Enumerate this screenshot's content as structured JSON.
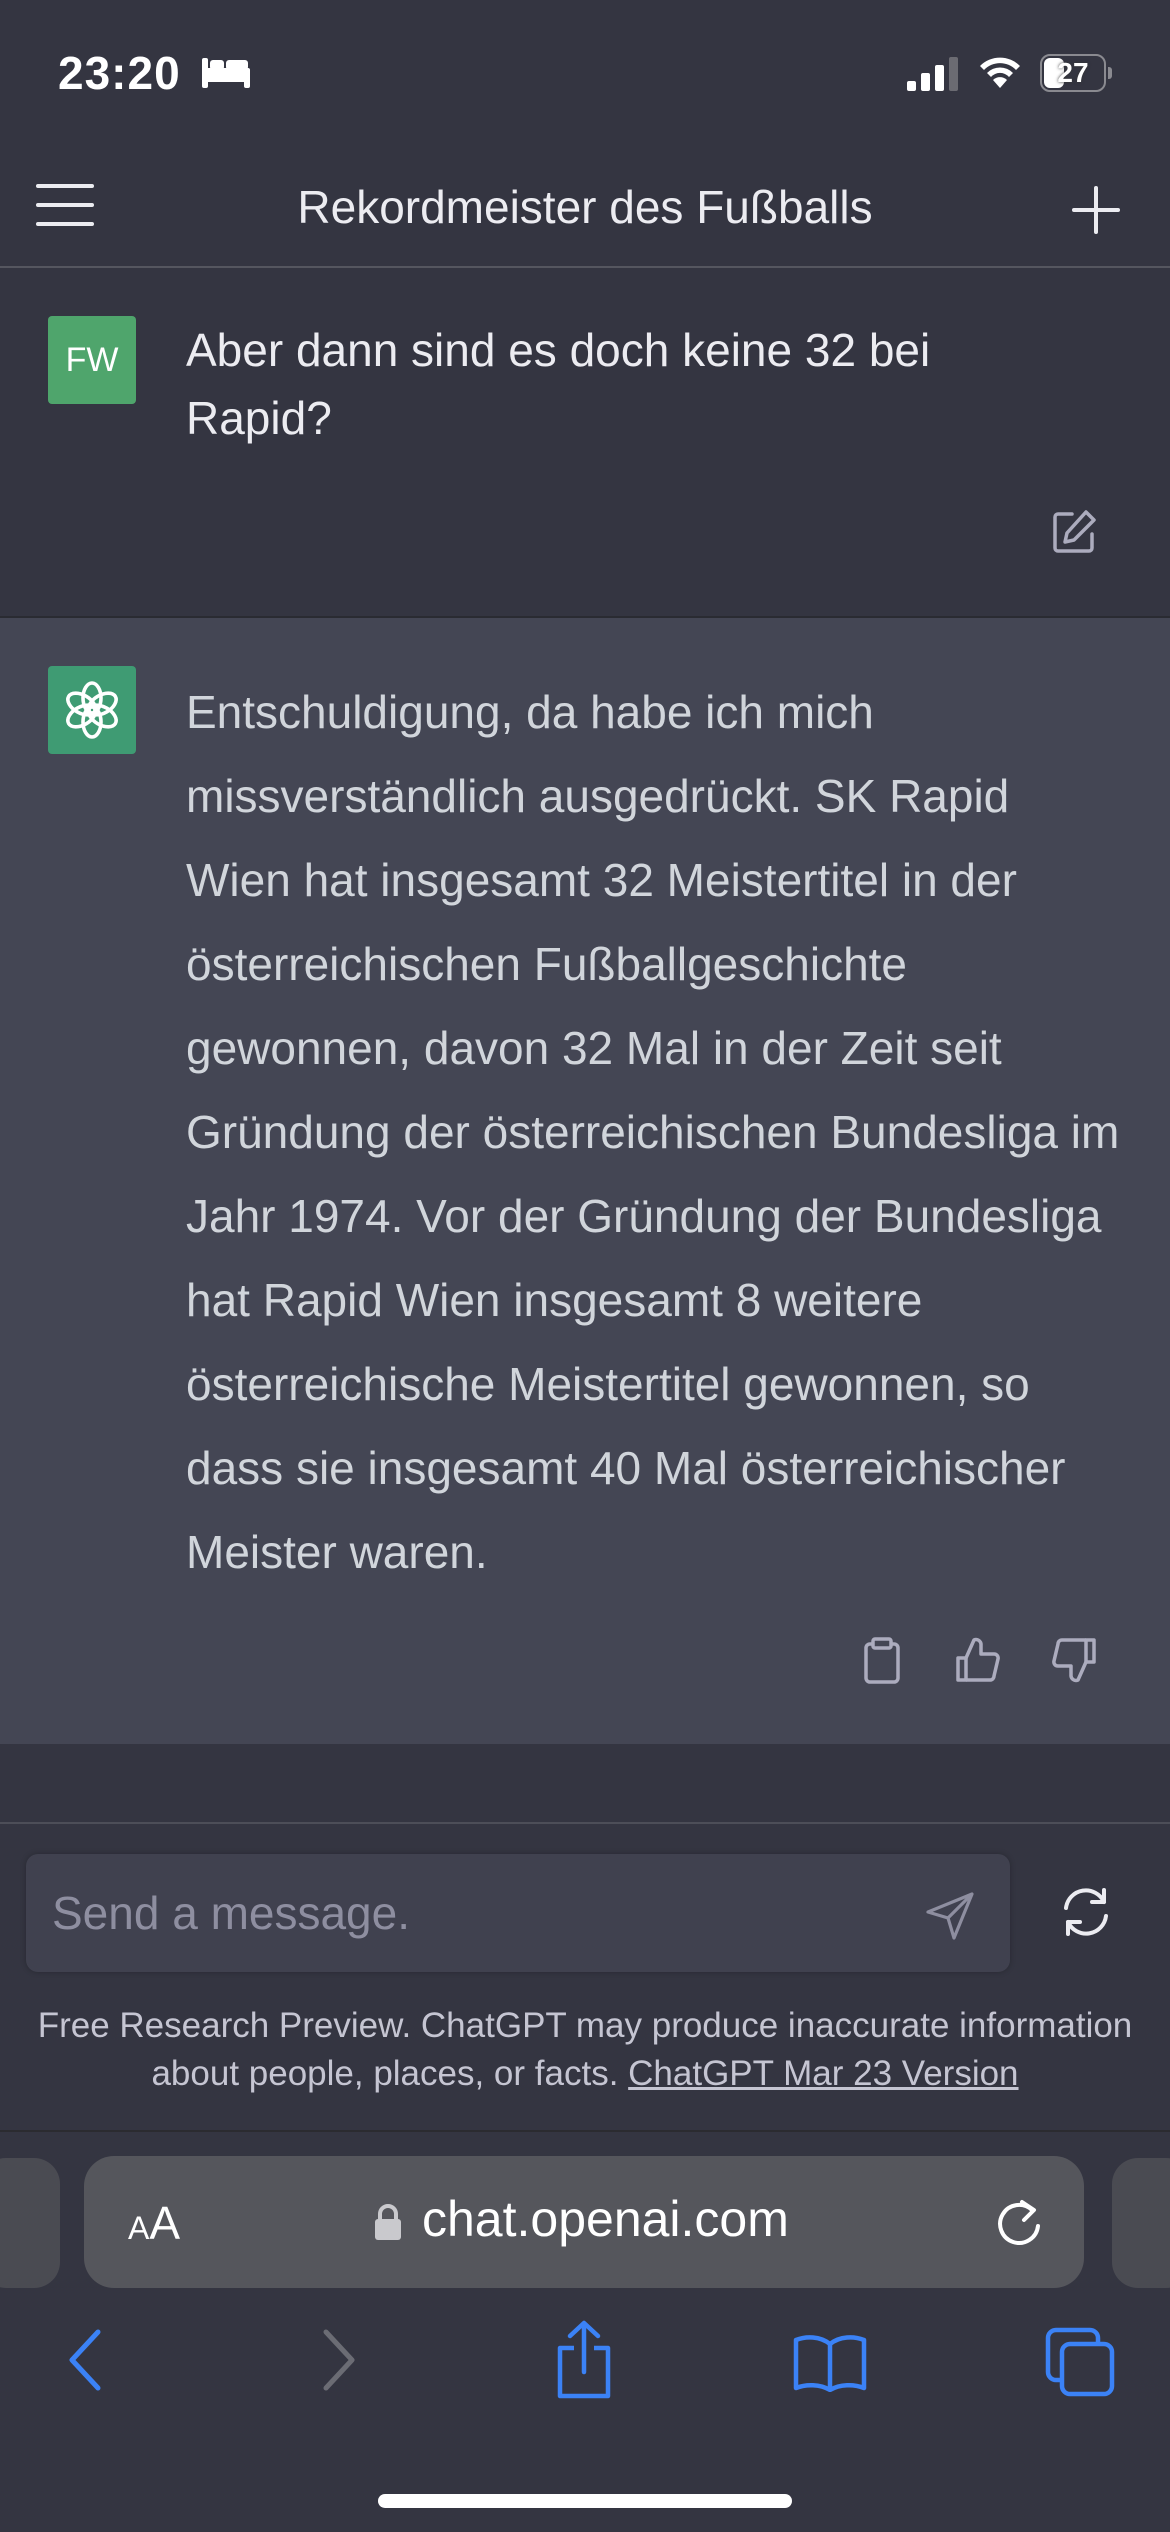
{
  "status_bar": {
    "time": "23:20",
    "battery": "27"
  },
  "header": {
    "title": "Rekordmeister des Fußballs"
  },
  "user_message": {
    "avatar": "FW",
    "text": "Aber dann sind es doch keine 32 bei Rapid?"
  },
  "assistant_message": {
    "text": "Entschuldigung, da habe ich mich missverständlich ausgedrückt. SK Rapid Wien hat insgesamt 32 Meistertitel in der österreichischen Fußballgeschichte gewonnen, davon 32 Mal in der Zeit seit Gründung der österreichischen Bundesliga im Jahr 1974. Vor der Gründung der Bundesliga hat Rapid Wien insgesamt 8 weitere österreichische Meistertitel gewonnen, so dass sie insgesamt 40 Mal österreichischer Meister waren."
  },
  "composer": {
    "placeholder": "Send a message."
  },
  "disclaimer": {
    "text": "Free Research Preview. ChatGPT may produce inaccurate information about people, places, or facts.",
    "link": "ChatGPT Mar 23 Version"
  },
  "browser": {
    "aa_small": "A",
    "aa_large": "A",
    "url": "chat.openai.com"
  },
  "colors": {
    "background": "#343541",
    "assistant_bg": "#444654",
    "user_avatar": "#4fa56c",
    "link_blue": "#3b82f6"
  },
  "icons": [
    "bed-icon",
    "signal-icon",
    "wifi-icon",
    "battery-icon",
    "menu-icon",
    "plus-icon",
    "edit-icon",
    "openai-logo-icon",
    "copy-icon",
    "thumbs-up-icon",
    "thumbs-down-icon",
    "send-icon",
    "regenerate-icon",
    "lock-icon",
    "reload-icon",
    "back-icon",
    "forward-icon",
    "share-icon",
    "bookmarks-icon",
    "tabs-icon"
  ]
}
